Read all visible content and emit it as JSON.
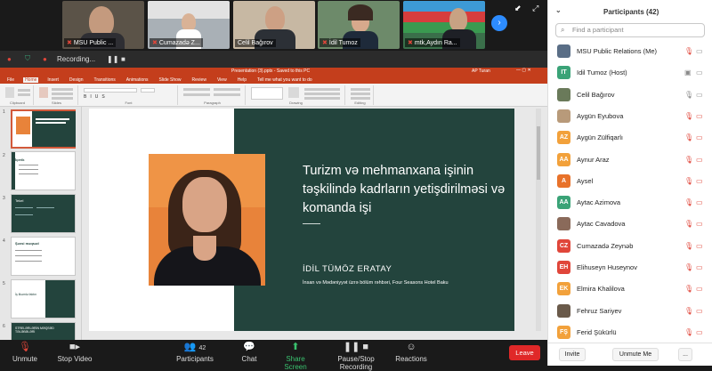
{
  "video_tiles": [
    {
      "name": "MSU Public ...",
      "muted": true
    },
    {
      "name": "Cumazadə Z...",
      "muted": true
    },
    {
      "name": "Celil Bağırov",
      "muted": false
    },
    {
      "name": "İdil Tumoz",
      "muted": true
    },
    {
      "name": "mtk,Aydın Ra...",
      "muted": true
    }
  ],
  "recording": {
    "label": "Recording..."
  },
  "ppt": {
    "title": "Presentation (3).pptx - Saved to this PC",
    "user": "AP Turan",
    "tabs": [
      "File",
      "Home",
      "Insert",
      "Design",
      "Transitions",
      "Animations",
      "Slide Show",
      "Review",
      "View",
      "Help",
      "Tell me what you want to do"
    ],
    "ribbon_groups": [
      "Clipboard",
      "Slides",
      "Font",
      "Paragraph",
      "Drawing",
      "Editing"
    ],
    "slide_numbers": [
      "1",
      "2",
      "3",
      "4",
      "5",
      "6"
    ],
    "thumb_titles": [
      "",
      "İçerik",
      "Tekel",
      "Şəxsi məqsəd",
      "İş ilkəmlə faktın",
      "STRELƏRLƏRİN MƏQSƏD TƏLƏBƏLƏRİ"
    ]
  },
  "slide": {
    "title": "Turizm və mehmanxana işinin təşkilində kadrların yetişdirilməsi və komanda işi",
    "name": "İDİL TÜMÖZ ERATAY",
    "role": "İnsan və Mədəniyyət üzrə bölüm rəhbəri, Four Seasons Hotel Baku"
  },
  "toolbar": {
    "unmute": "Unmute",
    "stop_video": "Stop Video",
    "participants": "Participants",
    "participants_count": "42",
    "chat": "Chat",
    "share_screen": "Share Screen",
    "pause_recording": "Pause/Stop Recording",
    "reactions": "Reactions",
    "leave": "Leave"
  },
  "panel": {
    "title": "Participants (42)",
    "search_placeholder": "Find a participant",
    "invite": "Invite",
    "unmute_me": "Unmute Me",
    "more": "...",
    "participants": [
      {
        "name": "MSU Public Relations (Me)",
        "initials": "",
        "color": "#5a6e86",
        "photo": true
      },
      {
        "name": "Idil Tumoz (Host)",
        "initials": "IT",
        "color": "#3aa377",
        "photo": false
      },
      {
        "name": "Celil Bağırov",
        "initials": "",
        "color": "#6a7a5a",
        "photo": true
      },
      {
        "name": "Aygün Eyubova",
        "initials": "",
        "color": "#b89a7a",
        "photo": true
      },
      {
        "name": "Aygün Zülfiqarlı",
        "initials": "AZ",
        "color": "#f2a13b",
        "photo": false
      },
      {
        "name": "Aynur Araz",
        "initials": "AA",
        "color": "#f2a13b",
        "photo": false
      },
      {
        "name": "Aysel",
        "initials": "A",
        "color": "#e8722a",
        "photo": false
      },
      {
        "name": "Aytac Azimova",
        "initials": "AA",
        "color": "#3aa377",
        "photo": false
      },
      {
        "name": "Aytac Cavadova",
        "initials": "",
        "color": "#8a6a5a",
        "photo": true
      },
      {
        "name": "Cumazadə Zeynəb",
        "initials": "CZ",
        "color": "#e0463a",
        "photo": false
      },
      {
        "name": "Elihuseyn Huseynov",
        "initials": "EH",
        "color": "#e0463a",
        "photo": false
      },
      {
        "name": "Elmira Khalilova",
        "initials": "EK",
        "color": "#f2a13b",
        "photo": false
      },
      {
        "name": "Fehruz Sariyev",
        "initials": "",
        "color": "#6a5a4a",
        "photo": true
      },
      {
        "name": "Ferid Şükürlü",
        "initials": "FŞ",
        "color": "#f2a13b",
        "photo": false
      }
    ]
  }
}
